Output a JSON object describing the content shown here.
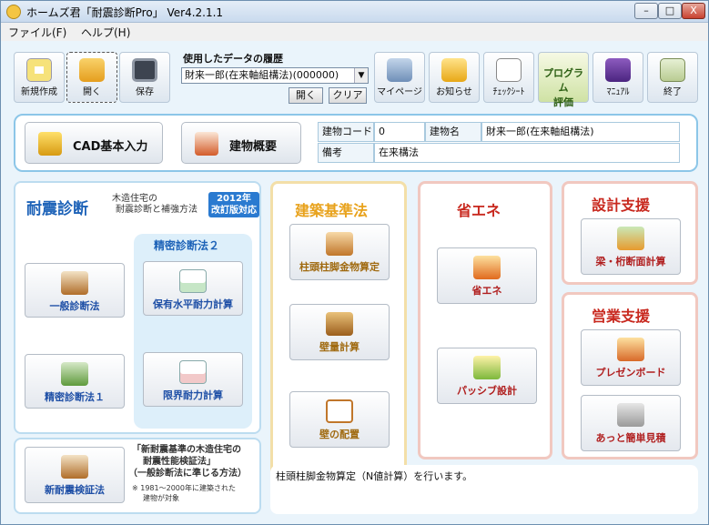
{
  "window": {
    "title": "ホームズ君「耐震診断Pro」 Ver4.2.1.1",
    "minimize": "–",
    "maximize": "□",
    "close": "X"
  },
  "menu": [
    "ファイル(F)",
    "ヘルプ(H)"
  ],
  "toolbar": {
    "new": "新規作成",
    "open": "開く",
    "save": "保存",
    "history_label": "使用したデータの履歴",
    "history_value": "財来一郎(在来軸組構法)(000000)",
    "history_arrow": "▼",
    "open_small": "開く",
    "clear": "クリア",
    "mypage": "マイページ",
    "notice": "お知らせ",
    "checksheet": "ﾁｪｯｸｼｰﾄ",
    "program_eval_1": "プログラム",
    "program_eval_2": "評価",
    "manual": "ﾏﾆｭｱﾙ",
    "exit": "終了"
  },
  "info": {
    "cad_button": "CAD基本入力",
    "overview_button": "建物概要",
    "code_label": "建物コード",
    "code_value": "0",
    "name_label": "建物名",
    "name_value": "財来一郎(在来軸組構法)",
    "note_label": "備考",
    "note_value": "在来構法"
  },
  "taishin": {
    "title": "耐震診断",
    "sub1": "木造住宅の",
    "sub2": "耐震診断と補強方法",
    "badge1": "2012年",
    "badge2": "改訂版対応",
    "seimitsu2_title": "精密診断法２",
    "btn_general": "一般診断法",
    "btn_seimitsu1": "精密診断法１",
    "btn_hoyu": "保有水平耐力計算",
    "btn_genkai": "限界耐力計算"
  },
  "shin": {
    "btn": "新耐震検証法",
    "desc1": "「新耐震基準の木造住宅の",
    "desc2": "耐震性能検証法」",
    "desc3": "（一般診断法に準じる方法）",
    "note1": "※ 1981～2000年に建築された",
    "note2": "建物が対象"
  },
  "kenchiku": {
    "title": "建築基準法",
    "btn1": "柱頭柱脚金物算定",
    "btn2": "壁量計算",
    "btn3": "壁の配置"
  },
  "shoene": {
    "title": "省エネ",
    "btn1": "省エネ",
    "btn2": "パッシブ設計"
  },
  "sekkei": {
    "title": "設計支援",
    "btn1": "梁・桁断面計算"
  },
  "eigyo": {
    "title": "営業支援",
    "btn1": "プレゼンボード",
    "btn2": "あっと簡単見積"
  },
  "status": "柱頭柱脚金物算定（N値計算）を行います。",
  "colors": {
    "taishin": "#1e63b8",
    "kenchiku": "#e8a21c",
    "red": "#c8281e",
    "badge": "#2a7ad0"
  }
}
